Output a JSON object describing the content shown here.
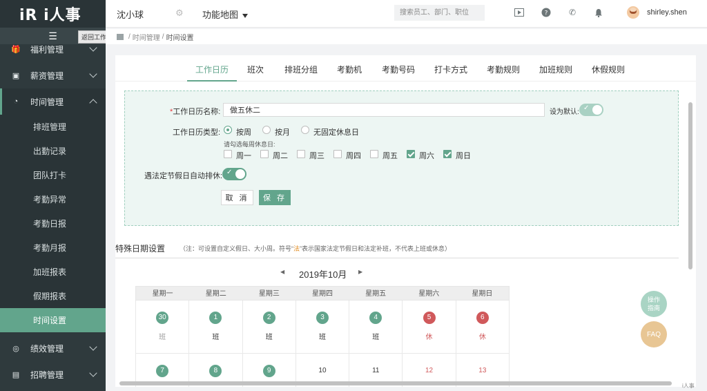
{
  "app": {
    "logo_text": "iR i人事",
    "corner_mark": "i人事"
  },
  "header": {
    "company": "沈小球",
    "func_map": "功能地图",
    "search_placeholder": "搜索员工、部门、职位",
    "user_name": "shirley.shen"
  },
  "sidebar": {
    "back_tooltip": "返回工作台",
    "groups": [
      {
        "label": "福利管理",
        "icon": "gift-icon"
      },
      {
        "label": "薪资管理",
        "icon": "briefcase-icon"
      },
      {
        "label": "时间管理",
        "icon": "clock-icon"
      },
      {
        "label": "绩效管理",
        "icon": "target-icon"
      },
      {
        "label": "招聘管理",
        "icon": "id-card-icon"
      }
    ],
    "sub_items": [
      "排班管理",
      "出勤记录",
      "团队打卡",
      "考勤异常",
      "考勤日报",
      "考勤月报",
      "加班报表",
      "假期报表",
      "时间设置"
    ]
  },
  "breadcrumb": {
    "level1": "时间管理",
    "sep": "/",
    "level2": "时间设置"
  },
  "tabs": [
    "工作日历",
    "班次",
    "排班分组",
    "考勤机",
    "考勤号码",
    "打卡方式",
    "考勤规则",
    "加班规则",
    "休假规则"
  ],
  "form": {
    "name_label": "工作日历名称:",
    "name_required": "*",
    "name_value": "做五休二",
    "default_label": "设为默认:",
    "type_label": "工作日历类型:",
    "type_options": [
      "按周",
      "按月",
      "无固定休息日"
    ],
    "weekly_hint": "请勾选每周休息日:",
    "weekdays": [
      "周一",
      "周二",
      "周三",
      "周四",
      "周五",
      "周六",
      "周日"
    ],
    "weekday_checked": [
      false,
      false,
      false,
      false,
      false,
      true,
      true
    ],
    "holiday_label": "遇法定节假日自动排休:",
    "cancel": "取 消",
    "save": "保 存"
  },
  "special": {
    "title": "特殊日期设置",
    "note_prefix": "（注：可设置自定义假日、大小周。符号“",
    "note_fa": "法",
    "note_suffix": "”表示国家法定节假日和法定补班，不代表上班或休息）"
  },
  "calendar": {
    "prev": "◀",
    "next": "▶",
    "month": "2019年10月",
    "week_headers": [
      "星期一",
      "星期二",
      "星期三",
      "星期四",
      "星期五",
      "星期六",
      "星期日"
    ],
    "rows": [
      [
        {
          "day": "30",
          "style": "g",
          "tag": "班",
          "tag_style": "grey"
        },
        {
          "day": "1",
          "style": "g",
          "tag": "班",
          "tag_style": ""
        },
        {
          "day": "2",
          "style": "g",
          "tag": "班",
          "tag_style": ""
        },
        {
          "day": "3",
          "style": "g",
          "tag": "班",
          "tag_style": ""
        },
        {
          "day": "4",
          "style": "g",
          "tag": "班",
          "tag_style": ""
        },
        {
          "day": "5",
          "style": "r",
          "tag": "休",
          "tag_style": "red"
        },
        {
          "day": "6",
          "style": "r",
          "tag": "休",
          "tag_style": "red"
        }
      ],
      [
        {
          "day": "7",
          "style": "g",
          "tag": "",
          "tag_style": ""
        },
        {
          "day": "8",
          "style": "g",
          "tag": "",
          "tag_style": ""
        },
        {
          "day": "9",
          "style": "g",
          "tag": "",
          "tag_style": ""
        },
        {
          "day": "10",
          "style": "plain",
          "tag": "",
          "tag_style": ""
        },
        {
          "day": "11",
          "style": "plain",
          "tag": "",
          "tag_style": ""
        },
        {
          "day": "12",
          "style": "plainred",
          "tag": "",
          "tag_style": ""
        },
        {
          "day": "13",
          "style": "plainred",
          "tag": "",
          "tag_style": ""
        }
      ]
    ]
  },
  "floating": {
    "help": "操作指南",
    "faq": "FAQ"
  },
  "colors": {
    "accent": "#62a58c",
    "rest": "#d0595b",
    "sidebar": "#2f3a3d"
  }
}
